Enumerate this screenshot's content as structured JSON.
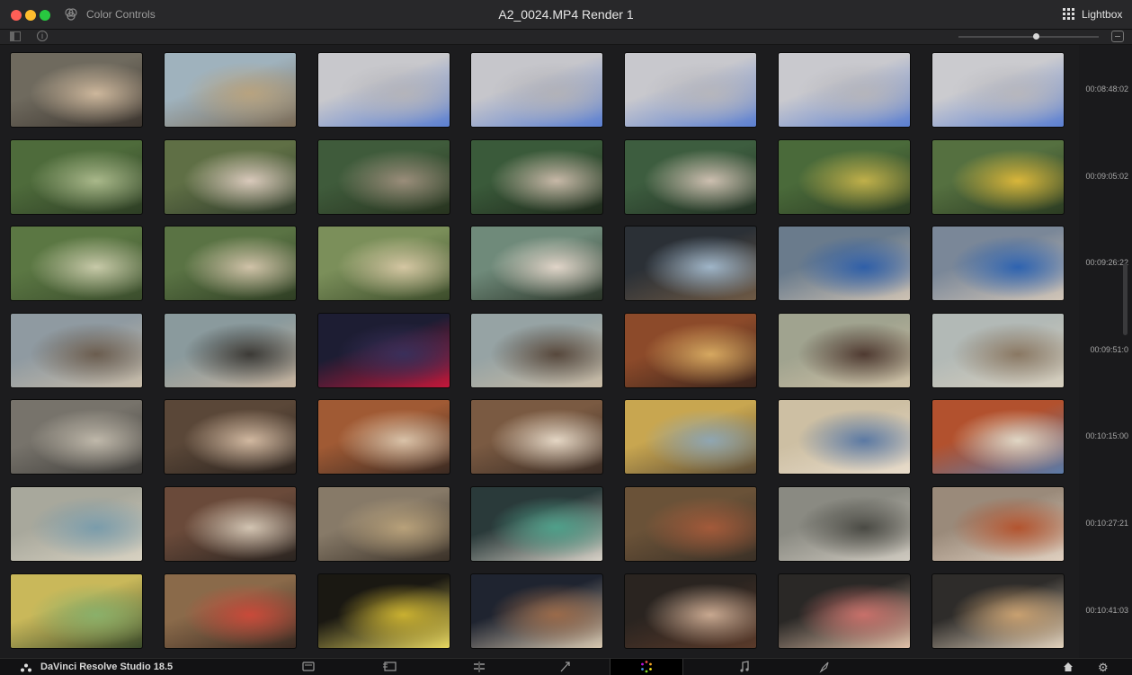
{
  "titlebar": {
    "panel_label": "Color Controls",
    "window_title": "A2_0024.MP4 Render 1",
    "lightbox_label": "Lightbox",
    "icons": [
      "color-controls-icon",
      "lightbox-grid-icon"
    ]
  },
  "toolbar": {
    "icons": [
      "sidebar-toggle-icon",
      "info-icon",
      "zoom-slider",
      "exit-lightbox-icon"
    ],
    "zoom_level": 0.55
  },
  "timestamps": [
    "00:08:48:02",
    "00:09:05:02",
    "00:09:26:22",
    "00:09:51:0",
    "00:10:15:00",
    "00:10:27:21",
    "00:10:41:03"
  ],
  "rows": [
    {
      "clips": [
        {
          "scene": "riverside couple, warm",
          "colors": [
            "#6f6a5e",
            "#cdb79c",
            "#3b342e"
          ]
        },
        {
          "scene": "city skyline and waterfront",
          "colors": [
            "#9fb2bd",
            "#b8a37f",
            "#7a6a55"
          ]
        },
        {
          "scene": "chat screen",
          "colors": [
            "#c8c8cc",
            "#b4b4ba",
            "#5b7fd1"
          ]
        },
        {
          "scene": "chat screen",
          "colors": [
            "#c6c6cb",
            "#b2b2b8",
            "#5b7fd1"
          ]
        },
        {
          "scene": "chat screen",
          "colors": [
            "#c8c8cd",
            "#b6b6bc",
            "#5b7fd1"
          ]
        },
        {
          "scene": "chat screen",
          "colors": [
            "#c9c9ce",
            "#b5b5bb",
            "#5b7fd1"
          ]
        },
        {
          "scene": "chat screen",
          "colors": [
            "#cbcbcf",
            "#b7b7bd",
            "#5b7fd1"
          ]
        }
      ]
    },
    {
      "clips": [
        {
          "scene": "park, green trees",
          "colors": [
            "#4e6b3b",
            "#a9b88a",
            "#2d3d24"
          ]
        },
        {
          "scene": "two people outdoors",
          "colors": [
            "#5f6f45",
            "#d9c9bb",
            "#2f3a2a"
          ]
        },
        {
          "scene": "dancing in park",
          "colors": [
            "#3f5b3b",
            "#9a8d7a",
            "#27331f"
          ]
        },
        {
          "scene": "blurred motion",
          "colors": [
            "#3a5a3a",
            "#c7b8a7",
            "#1f2a1c"
          ]
        },
        {
          "scene": "blurred close up",
          "colors": [
            "#3d5d3f",
            "#cdbfb0",
            "#223023"
          ]
        },
        {
          "scene": "park blur, yellow",
          "colors": [
            "#4a6a3a",
            "#c0b04a",
            "#2a3a22"
          ]
        },
        {
          "scene": "park, yellow structure",
          "colors": [
            "#557040",
            "#d9b63a",
            "#2b3b22"
          ]
        }
      ]
    },
    {
      "clips": [
        {
          "scene": "sports field",
          "colors": [
            "#5b7743",
            "#c7c9a8",
            "#3a4c2c"
          ]
        },
        {
          "scene": "playing ball",
          "colors": [
            "#5a7344",
            "#d0c2a8",
            "#2e3d23"
          ]
        },
        {
          "scene": "running kids",
          "colors": [
            "#7b8f5a",
            "#d4c6a2",
            "#3b4b2a"
          ]
        },
        {
          "scene": "woman with light",
          "colors": [
            "#6f8a7a",
            "#e0d4c8",
            "#2a3428"
          ]
        },
        {
          "scene": "computer screen",
          "colors": [
            "#2b3036",
            "#9fb5c8",
            "#6f5a45"
          ]
        },
        {
          "scene": "office, blue shirts",
          "colors": [
            "#6a7b8c",
            "#2f5fa8",
            "#cfc3b4"
          ]
        },
        {
          "scene": "office, blue shirt",
          "colors": [
            "#7a8798",
            "#2e63b0",
            "#d2c6b8"
          ]
        }
      ]
    },
    {
      "clips": [
        {
          "scene": "skyline couple",
          "colors": [
            "#8f9aa1",
            "#6b5d4f",
            "#c8bca9"
          ]
        },
        {
          "scene": "woman at window",
          "colors": [
            "#8a9a9d",
            "#3c3a36",
            "#c6b39e"
          ]
        },
        {
          "scene": "dark screen",
          "colors": [
            "#1d1d33",
            "#3a2f5a",
            "#c2183a"
          ]
        },
        {
          "scene": "riverside walk",
          "colors": [
            "#96a3a4",
            "#57483c",
            "#c9bba5"
          ]
        },
        {
          "scene": "temple, golden",
          "colors": [
            "#8c4a2a",
            "#d6a860",
            "#3a241b"
          ]
        },
        {
          "scene": "woman by river",
          "colors": [
            "#a0a38f",
            "#4f3a31",
            "#cfc1a6"
          ]
        },
        {
          "scene": "city skyline",
          "colors": [
            "#b2b9b6",
            "#8a7863",
            "#d7cfbe"
          ]
        }
      ]
    },
    {
      "clips": [
        {
          "scene": "street shops",
          "colors": [
            "#77736b",
            "#bfb8aa",
            "#3f3d3a"
          ]
        },
        {
          "scene": "indoor talking",
          "colors": [
            "#5a4738",
            "#d1b8a0",
            "#2b231e"
          ]
        },
        {
          "scene": "cafe, orange walls",
          "colors": [
            "#a05a34",
            "#d9c2a8",
            "#3a2a22"
          ]
        },
        {
          "scene": "cafe conversation",
          "colors": [
            "#7a5a42",
            "#e4d6c4",
            "#3a2c24"
          ]
        },
        {
          "scene": "river view through arch",
          "colors": [
            "#c8a650",
            "#8fa6b2",
            "#5a4a35"
          ]
        },
        {
          "scene": "smiling man outdoors",
          "colors": [
            "#cdbfa3",
            "#5b79a3",
            "#e8dccb"
          ]
        },
        {
          "scene": "notice board",
          "colors": [
            "#b2512e",
            "#e0d6c4",
            "#5a7aa8"
          ]
        }
      ]
    },
    {
      "clips": [
        {
          "scene": "shop counter",
          "colors": [
            "#a8a89c",
            "#7a9cab",
            "#d8d2c2"
          ]
        },
        {
          "scene": "close up hands",
          "colors": [
            "#6a4a3a",
            "#d2c4b2",
            "#2a2420"
          ]
        },
        {
          "scene": "couple in alley",
          "colors": [
            "#877a68",
            "#b8a17a",
            "#3a3128"
          ]
        },
        {
          "scene": "night street",
          "colors": [
            "#2a3a3a",
            "#4fa08a",
            "#d8d2c8"
          ]
        },
        {
          "scene": "graffiti alley",
          "colors": [
            "#6a5238",
            "#a35a3a",
            "#3a3026"
          ]
        },
        {
          "scene": "man in alley",
          "colors": [
            "#8a8a82",
            "#4a4a44",
            "#cfcac0"
          ]
        },
        {
          "scene": "woman eating",
          "colors": [
            "#9a8a7a",
            "#b3542f",
            "#e0d0c0"
          ]
        }
      ]
    },
    {
      "clips": [
        {
          "scene": "yellow shirt, sunny",
          "colors": [
            "#c9b85a",
            "#8ab06a",
            "#3a4a2a"
          ]
        },
        {
          "scene": "colorful alley",
          "colors": [
            "#8a6a4a",
            "#c94a3a",
            "#3a2a22"
          ]
        },
        {
          "scene": "bokeh lights",
          "colors": [
            "#1a1812",
            "#c9b030",
            "#e8d860"
          ]
        },
        {
          "scene": "night dining",
          "colors": [
            "#1f2430",
            "#9a6a4a",
            "#d8c8b0"
          ]
        },
        {
          "scene": "man at night",
          "colors": [
            "#2a2420",
            "#c8a890",
            "#5a3a2a"
          ]
        },
        {
          "scene": "woman at dinner",
          "colors": [
            "#2a2826",
            "#c8706a",
            "#e0c0a8"
          ]
        },
        {
          "scene": "group dinner",
          "colors": [
            "#2e2c2a",
            "#c8a070",
            "#e2d2bc"
          ]
        }
      ]
    }
  ],
  "footer": {
    "brand": "DaVinci Resolve Studio 18.5",
    "pages": [
      {
        "name": "media-page-icon",
        "active": false
      },
      {
        "name": "cut-page-icon",
        "active": false
      },
      {
        "name": "edit-page-icon",
        "active": false
      },
      {
        "name": "fusion-page-icon",
        "active": false
      },
      {
        "name": "color-page-icon",
        "active": true
      },
      {
        "name": "fairlight-page-icon",
        "active": false
      },
      {
        "name": "deliver-page-icon",
        "active": false
      }
    ],
    "icons": [
      "home-icon",
      "settings-gear-icon"
    ]
  }
}
